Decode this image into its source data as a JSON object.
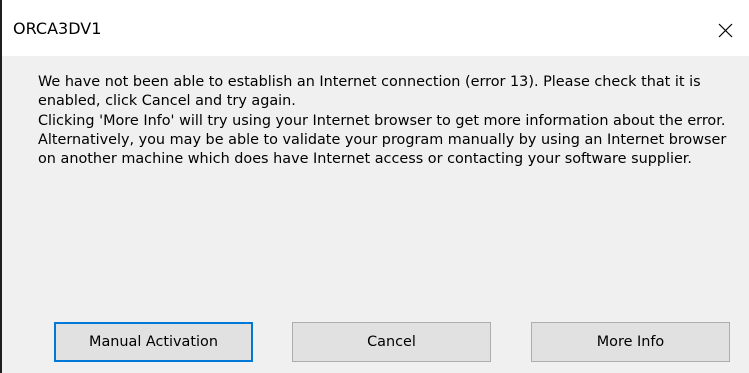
{
  "window": {
    "title": "ORCA3DV1",
    "close_icon": "close-icon"
  },
  "message": {
    "line1": "We have not been able to establish an Internet connection (error 13).  Please check that it is enabled, click Cancel and try again.",
    "line2": "Clicking 'More Info' will try using your Internet browser to get more information about the error.",
    "line3": "Alternatively, you may be able to validate your program manually by using an Internet browser on another machine which does have Internet access or contacting your software supplier."
  },
  "buttons": {
    "manual_activation": "Manual Activation",
    "cancel": "Cancel",
    "more_info": "More Info"
  },
  "colors": {
    "focus_border": "#0078d7",
    "dialog_bg": "#f0f0f0",
    "button_bg": "#e1e1e1"
  }
}
